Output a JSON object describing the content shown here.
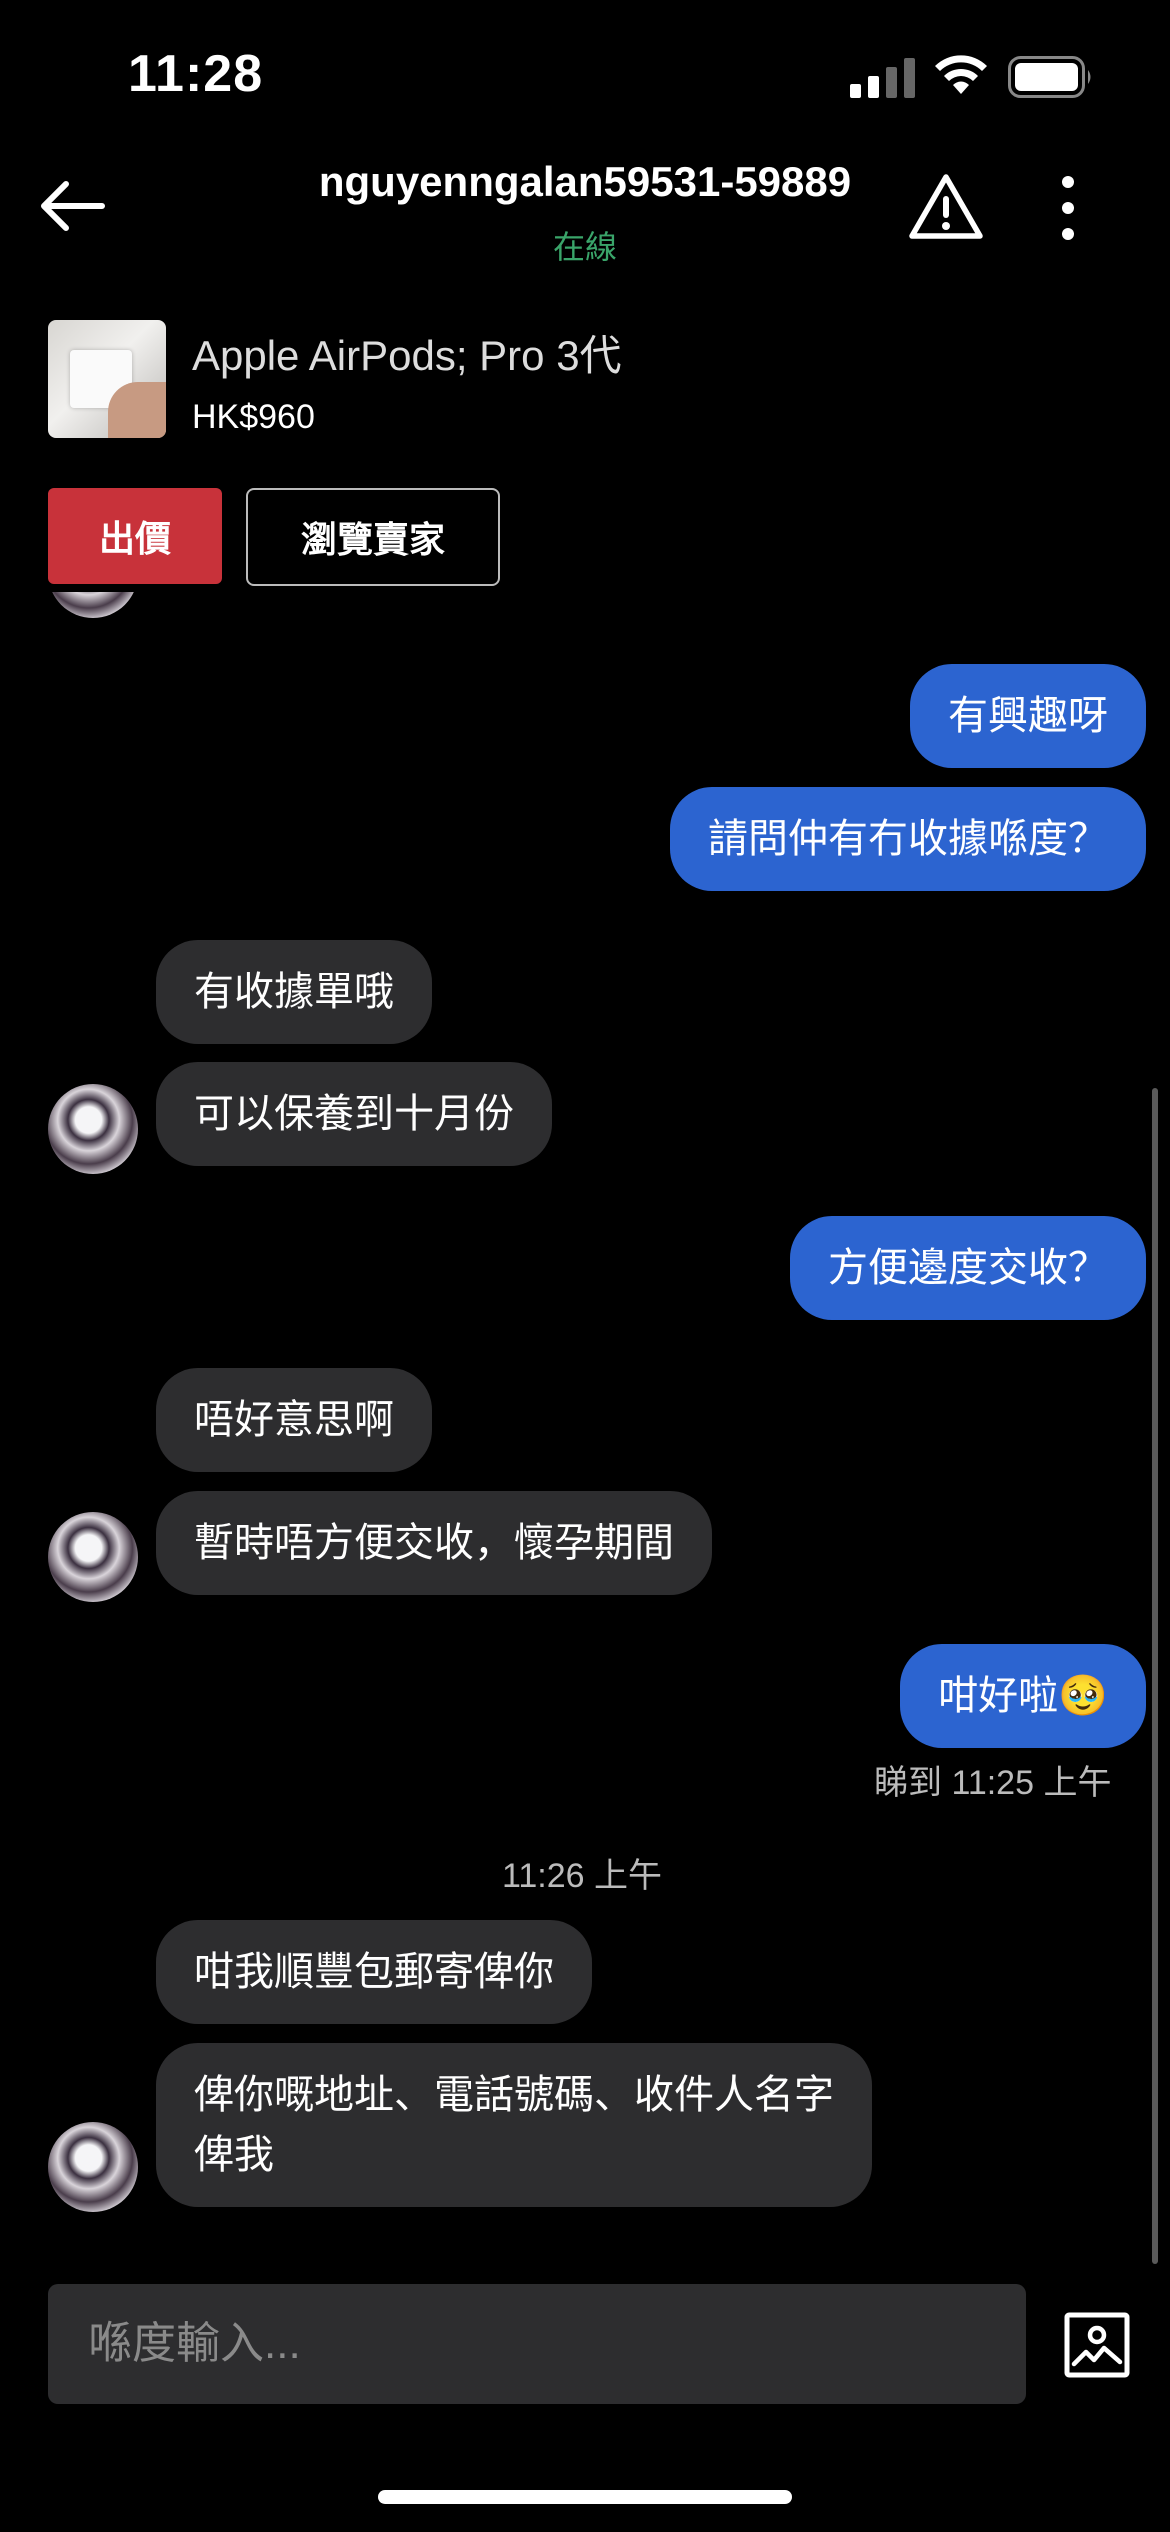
{
  "status_bar": {
    "time": "11:28"
  },
  "header": {
    "username": "nguyenngalan59531-59889",
    "status": "在線"
  },
  "product": {
    "title": "Apple AirPods; Pro 3代",
    "price": "HK$960"
  },
  "actions": {
    "offer_label": "出價",
    "browse_seller_label": "瀏覽賣家"
  },
  "messages": [
    {
      "from": "me",
      "text": "有興趣呀"
    },
    {
      "from": "me",
      "text": "請問仲有冇收據喺度？"
    },
    {
      "from": "them",
      "text": "有收據單哦"
    },
    {
      "from": "them",
      "text": "可以保養到十月份"
    },
    {
      "from": "me",
      "text": "方便邊度交收？"
    },
    {
      "from": "them",
      "text": "唔好意思啊"
    },
    {
      "from": "them",
      "text": "暫時唔方便交收，懷孕期間"
    },
    {
      "from": "me",
      "text": "咁好啦🥹"
    },
    {
      "from": "them",
      "text": "咁我順豐包郵寄俾你"
    },
    {
      "from": "them",
      "text_line1": "俾你嘅地址、電話號碼、收件人名字",
      "text_line2": "俾我"
    }
  ],
  "read_receipt": "睇到 11:25 上午",
  "time_divider": "11:26 上午",
  "composer": {
    "placeholder": "喺度輸入..."
  },
  "colors": {
    "my_bubble": "#2c64d0",
    "their_bubble": "#2d2d2f",
    "offer_button": "#c8323a",
    "online": "#3aa56a"
  }
}
